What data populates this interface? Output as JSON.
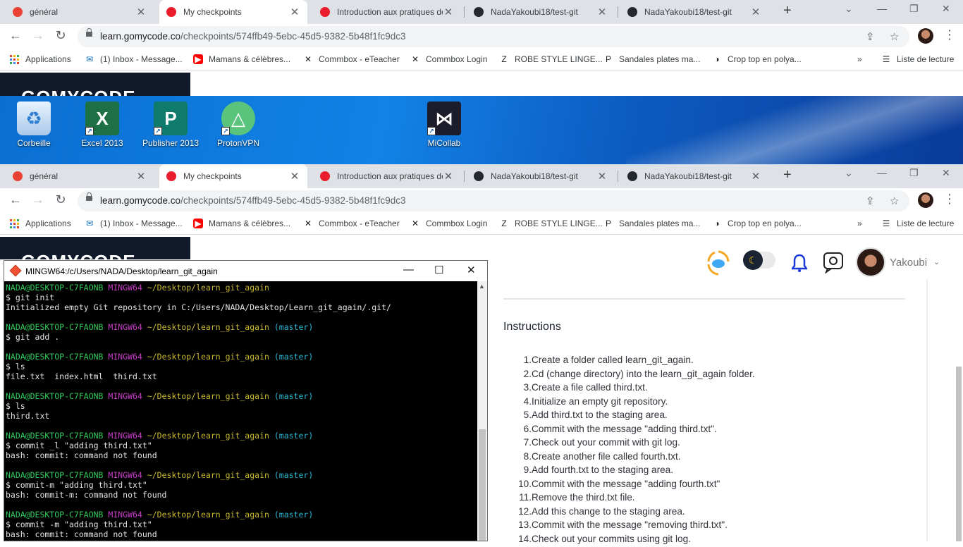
{
  "browser": {
    "tabs": [
      {
        "title": "général",
        "favicon_color": "#e94235"
      },
      {
        "title": "My checkpoints",
        "favicon_color": "#ea1d2c",
        "active": true
      },
      {
        "title": "Introduction aux pratiques de",
        "favicon_color": "#ea1d2c"
      },
      {
        "title": "NadaYakoubi18/test-git",
        "favicon_color": "#24292f"
      },
      {
        "title": "NadaYakoubi18/test-git",
        "favicon_color": "#24292f"
      }
    ],
    "url_host": "learn.gomycode.co",
    "url_path": "/checkpoints/574ffb49-5ebc-45d5-9382-5b48f1fc9dc3",
    "bookmarks": [
      {
        "label": "Applications",
        "icon": "apps-grid-icon"
      },
      {
        "label": "(1) Inbox - Message...",
        "icon": "outlook-icon"
      },
      {
        "label": "Mamans & célèbres...",
        "icon": "youtube-icon"
      },
      {
        "label": "Commbox - eTeacher",
        "icon": "commbox-icon"
      },
      {
        "label": "Commbox Login",
        "icon": "commbox-icon"
      },
      {
        "label": "ROBE STYLE LINGE...",
        "icon": "zara-icon"
      },
      {
        "label": "Sandales plates ma...",
        "icon": "pb-icon"
      },
      {
        "label": "Crop top en polya...",
        "icon": "shein-icon"
      }
    ],
    "more_bookmarks": "»",
    "reading_list": "Liste de lecture",
    "tab_close": "✕",
    "new_tab": "+"
  },
  "desktop": {
    "icons": [
      {
        "label": "Corbeille",
        "icon": "recycle-bin-icon"
      },
      {
        "label": "Excel 2013",
        "icon": "excel-icon"
      },
      {
        "label": "Publisher 2013",
        "icon": "publisher-icon"
      },
      {
        "label": "ProtonVPN",
        "icon": "protonvpn-icon"
      },
      {
        "label": "MiCollab",
        "icon": "micollab-icon"
      }
    ]
  },
  "site": {
    "logo": "GOMYCODE",
    "user_name": "Yakoubi",
    "instructions_title": "Instructions",
    "instructions": [
      "Create a folder called learn_git_again.",
      "Cd (change directory) into the learn_git_again folder.",
      "Create a file called third.txt.",
      "Initialize an empty git repository.",
      "Add third.txt to the staging area.",
      "Commit with the message \"adding third.txt\".",
      "Check out your commit with git log.",
      "Create another file called fourth.txt.",
      "Add fourth.txt to the staging area.",
      "Commit with the message \"adding fourth.txt\"",
      "Remove the third.txt file.",
      "Add this change to the staging area.",
      "Commit with the message \"removing third.txt\".",
      "Check out your commits using git log."
    ]
  },
  "terminal": {
    "title": "MINGW64:/c/Users/NADA/Desktop/learn_git_again",
    "user": "NADA@DESKTOP-C7FAONB",
    "env": "MINGW64",
    "path": "~/Desktop/learn_git_again",
    "branch": "(master)",
    "blocks": [
      {
        "branch": false,
        "cmd": "$ git init",
        "out": [
          "Initialized empty Git repository in C:/Users/NADA/Desktop/Learn_git_again/.git/"
        ]
      },
      {
        "branch": true,
        "cmd": "$ git add .",
        "out": []
      },
      {
        "branch": true,
        "cmd": "$ ls",
        "out": [
          "file.txt  index.html  third.txt"
        ]
      },
      {
        "branch": true,
        "cmd": "$ ls",
        "out": [
          "third.txt"
        ]
      },
      {
        "branch": true,
        "cmd": "$ commit _l \"adding third.txt\"",
        "out": [
          "bash: commit: command not found"
        ]
      },
      {
        "branch": true,
        "cmd": "$ commit-m \"adding third.txt\"",
        "out": [
          "bash: commit-m: command not found"
        ]
      },
      {
        "branch": true,
        "cmd": "$ commit -m \"adding third.txt\"",
        "out": [
          "bash: commit: command not found"
        ]
      }
    ]
  }
}
